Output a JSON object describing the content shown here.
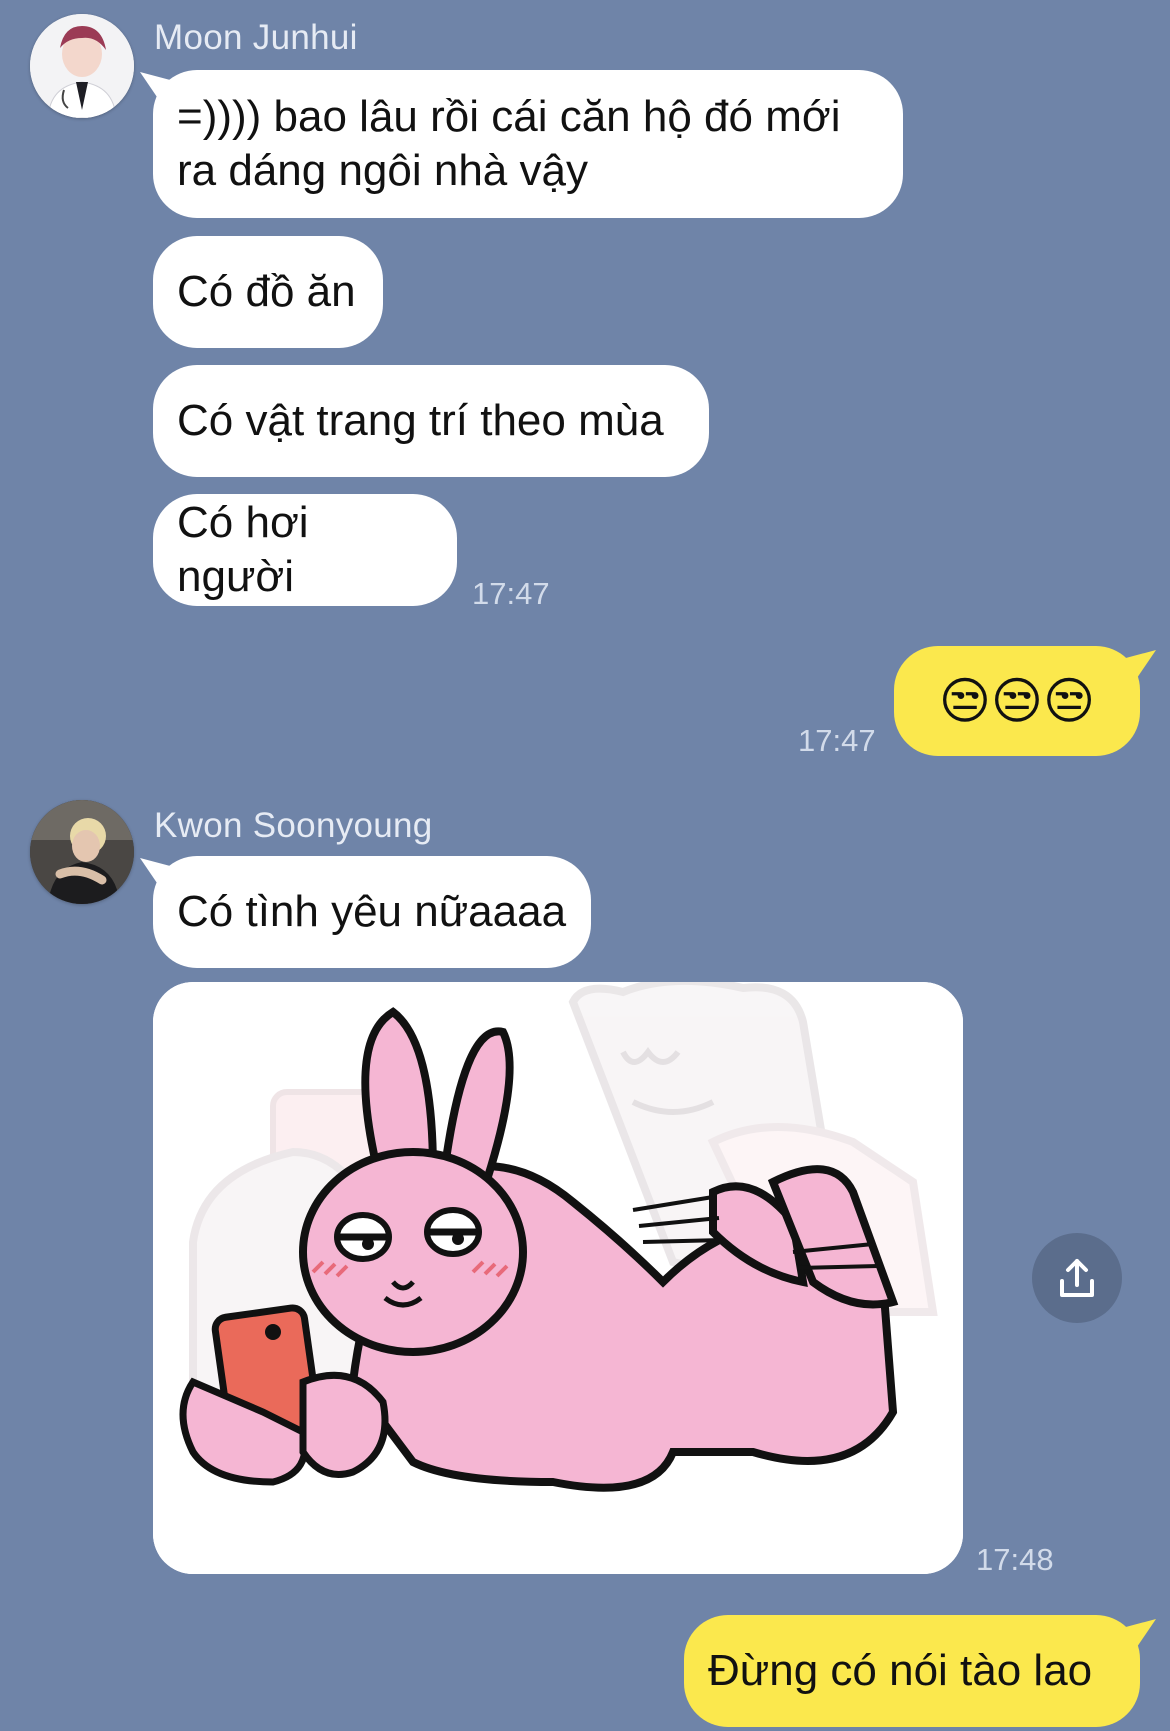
{
  "messages": {
    "moon": {
      "name": "Moon Junhui",
      "bubble1": "=)))) bao lâu rồi cái căn hộ đó mới\nra dáng ngôi nhà vậy",
      "bubble2": "Có đồ ăn",
      "bubble3": "Có vật trang trí theo mùa",
      "bubble4": "Có hơi người",
      "time": "17:47"
    },
    "me1": {
      "text": "😒😒😒",
      "time": "17:47"
    },
    "kwon": {
      "name": "Kwon Soonyoung",
      "bubble1": "Có tình yêu nữaaaa",
      "sticker_time": "17:48"
    },
    "me2": {
      "text": "Đừng có nói tào lao"
    }
  },
  "icons": {
    "share": "share-upload-icon",
    "avatar_moon": "avatar",
    "avatar_kwon": "avatar",
    "sticker": "pink-rabbit-sticker"
  },
  "colors": {
    "background": "#6f84a8",
    "incoming_bubble": "#ffffff",
    "outgoing_bubble": "#fbe84d"
  }
}
